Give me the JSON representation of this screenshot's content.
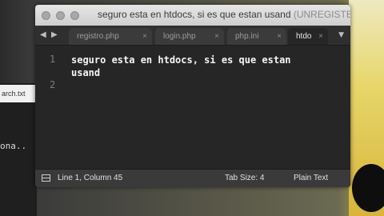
{
  "background": {
    "left_file": "arch.txt",
    "left_text": "ona.."
  },
  "window": {
    "title": "seguro esta en htdocs, si es que estan usand",
    "title_suffix": "(UNREGISTERED",
    "nav": {
      "back": "◀",
      "forward": "▶"
    },
    "tabs": [
      {
        "label": "registro.php",
        "close": "×",
        "active": false
      },
      {
        "label": "login.php",
        "close": "×",
        "active": false
      },
      {
        "label": "php.ini",
        "close": "×",
        "active": false
      },
      {
        "label": "htdo",
        "close": "×",
        "active": true
      }
    ],
    "tab_menu": "▼",
    "editor": {
      "line_numbers": [
        "1",
        "2"
      ],
      "content": "seguro esta en htdocs, si es que estan usand"
    },
    "status": {
      "position": "Line 1, Column 45",
      "tab_size": "Tab Size: 4",
      "syntax": "Plain Text"
    }
  }
}
